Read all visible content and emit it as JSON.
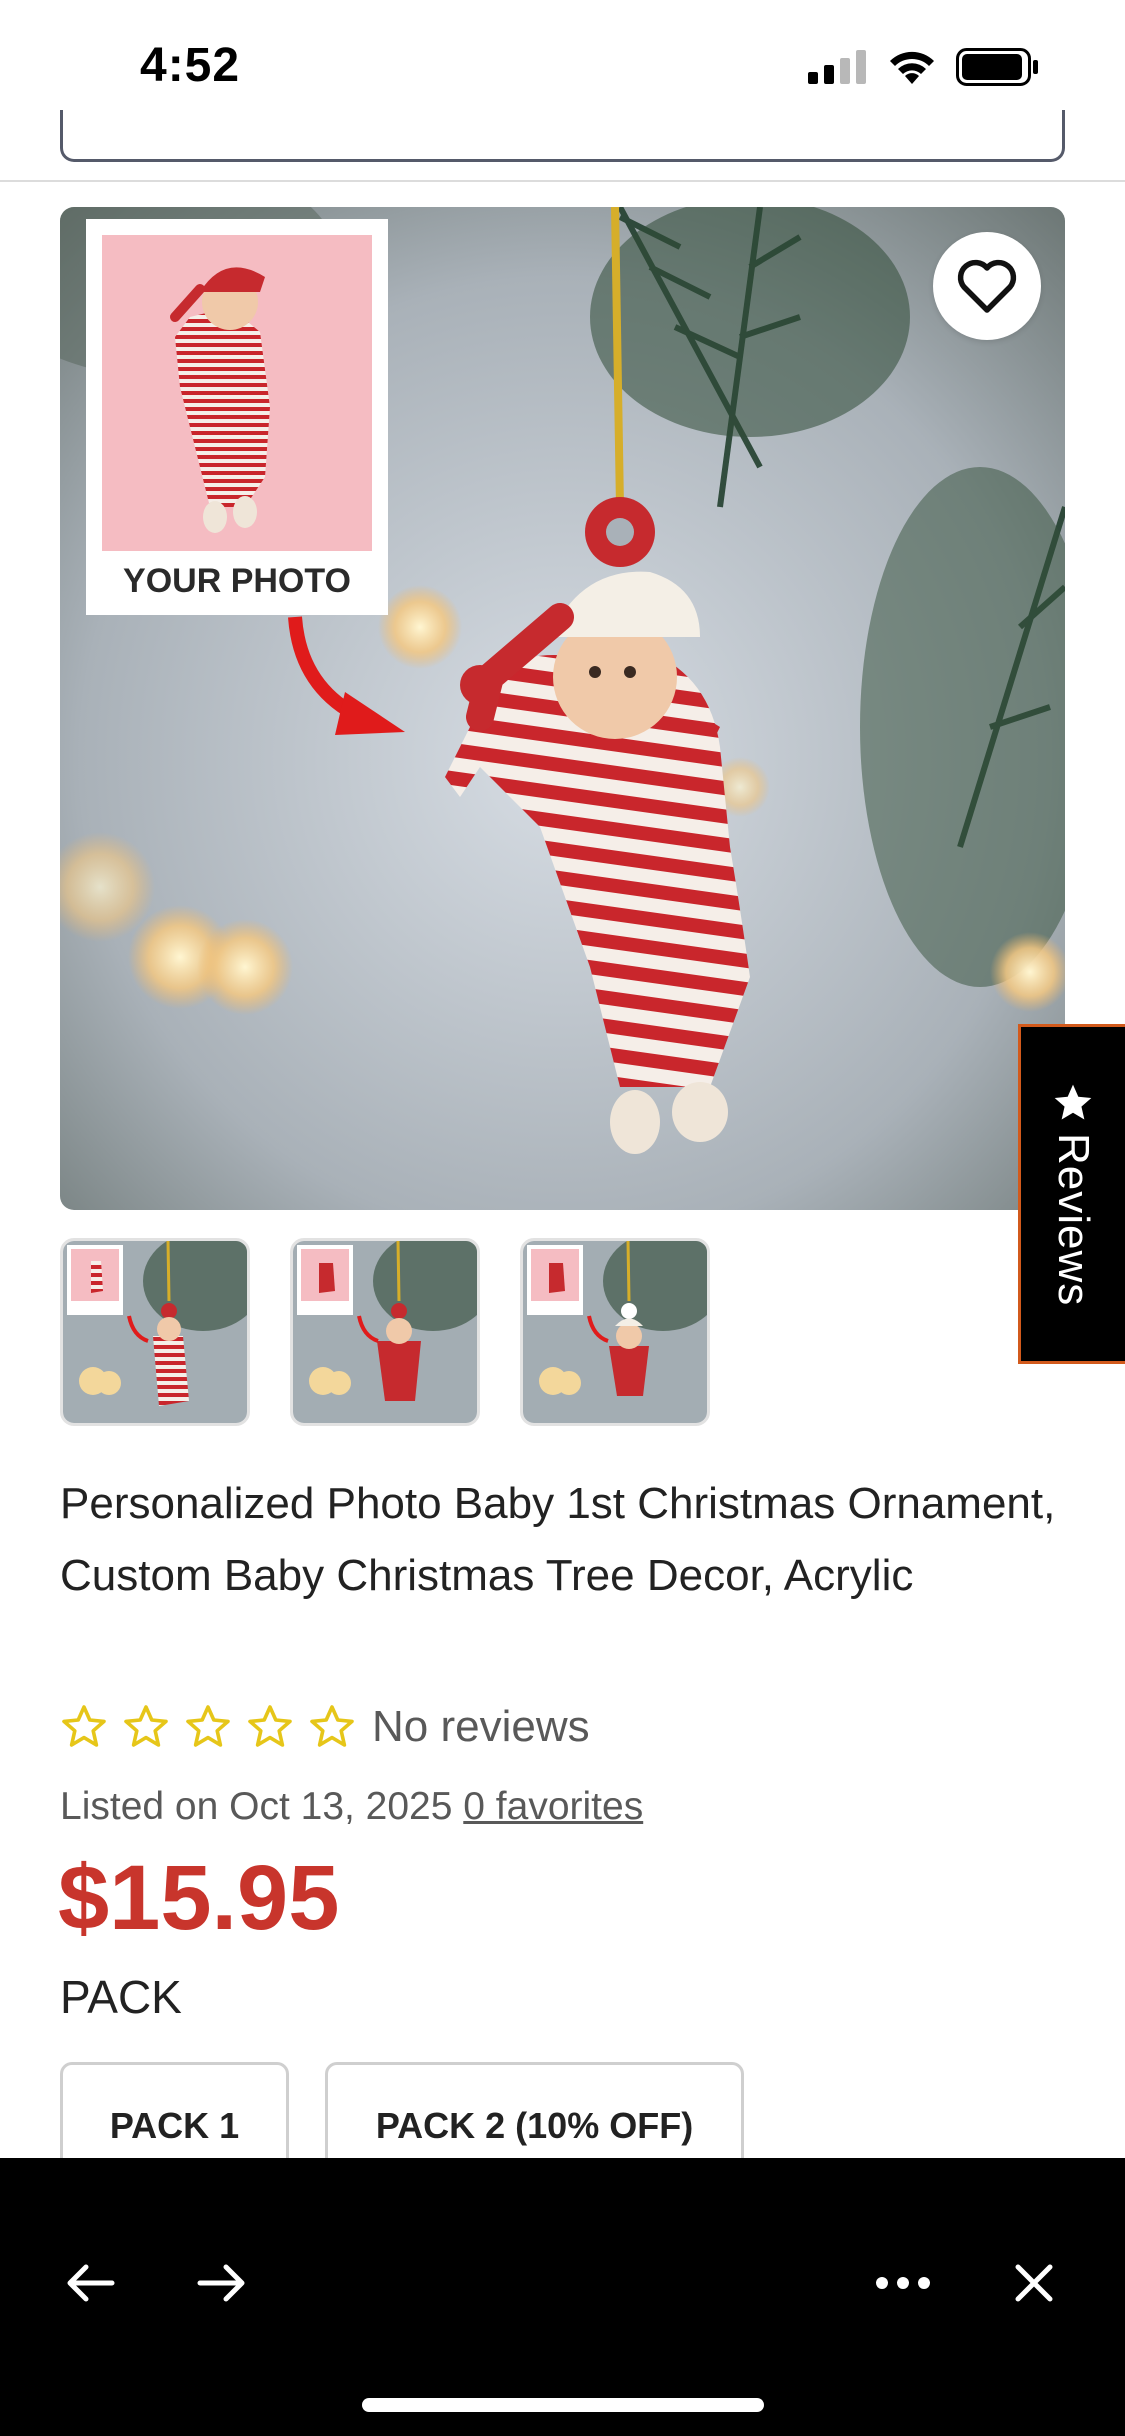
{
  "status_bar": {
    "time": "4:52"
  },
  "product": {
    "image_overlay_text": "YOUR PHOTO",
    "title": "Personalized Photo Baby 1st Christmas Ornament, Custom Baby Christmas Tree Decor, Acrylic",
    "rating_stars": 0,
    "no_reviews_label": "No reviews",
    "listed_text": "Listed on Oct 13, 2025",
    "favorites_link": "0 favorites",
    "price": "$15.95",
    "variation_label": "PACK",
    "pack_options": [
      "PACK 1",
      "PACK 2 (10% OFF)"
    ]
  },
  "reviews_tab": {
    "label": "Reviews",
    "icon": "star-icon"
  },
  "thumbnails": [
    {
      "name": "thumbnail-striped-pajamas"
    },
    {
      "name": "thumbnail-red-outfit"
    },
    {
      "name": "thumbnail-red-white-outfit"
    }
  ],
  "colors": {
    "price_red": "#c8352c",
    "star_yellow": "#e6c619",
    "reviews_tab_border": "#d25a1c",
    "bottom_bar": "#000000"
  }
}
